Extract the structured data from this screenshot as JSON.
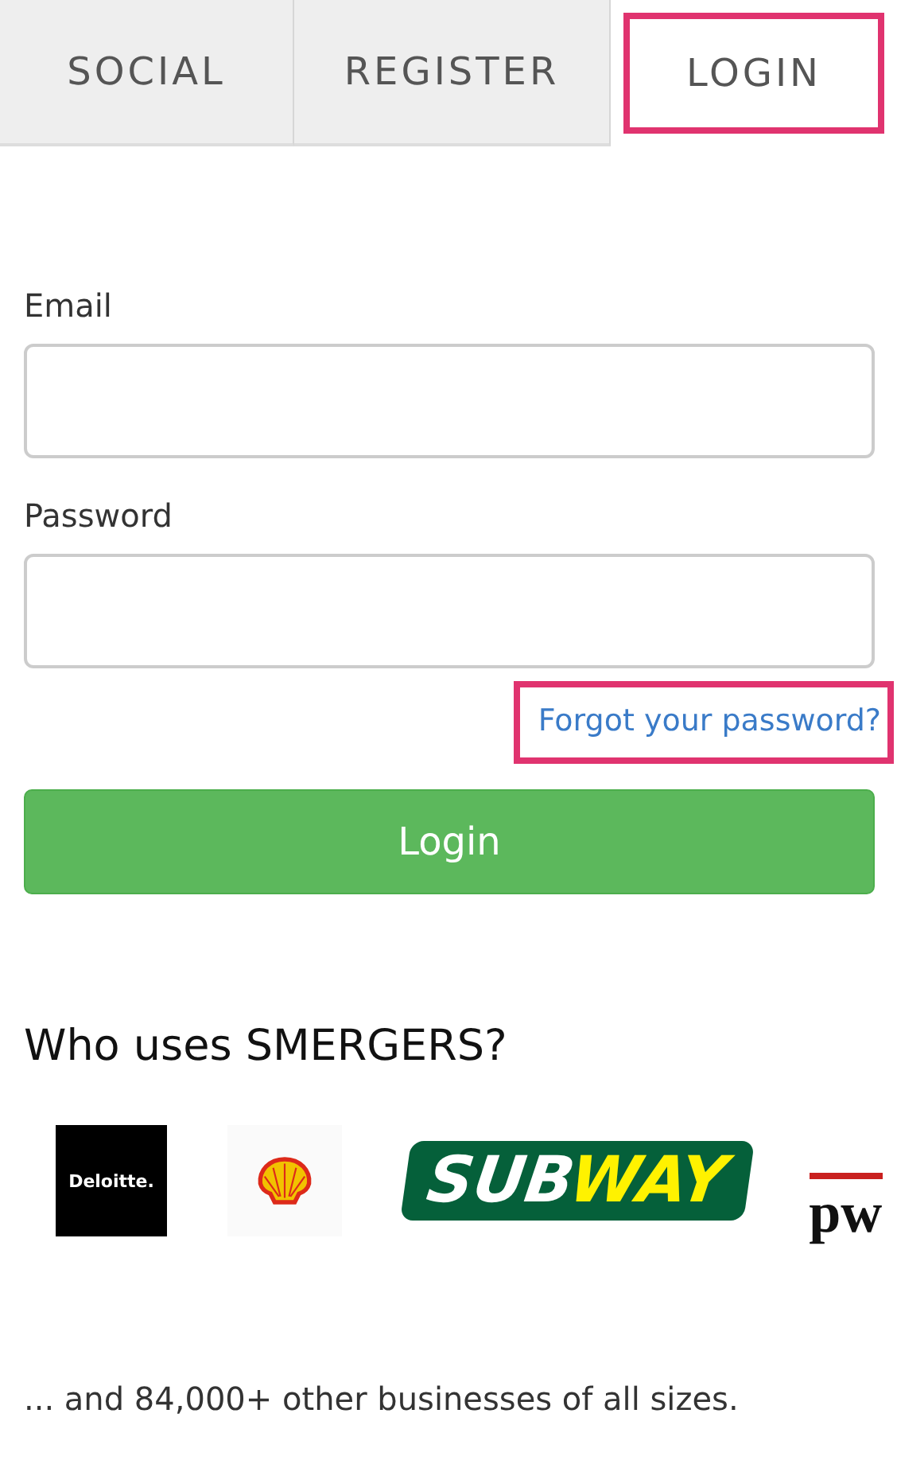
{
  "tabs": [
    {
      "label": "SOCIAL",
      "selected": false,
      "highlighted": false
    },
    {
      "label": "REGISTER",
      "selected": false,
      "highlighted": false
    },
    {
      "label": "LOGIN",
      "selected": true,
      "highlighted": true
    }
  ],
  "form": {
    "fields": [
      {
        "label": "Email"
      },
      {
        "label": "Password"
      }
    ],
    "forgot_link": {
      "text": "Forgot your password?",
      "highlighted": true
    },
    "submit": "Login"
  },
  "clients": {
    "heading": "Who uses SMERGERS?",
    "logos": [
      {
        "kind": "deloitte",
        "text": "Deloitte."
      },
      {
        "kind": "shell"
      },
      {
        "kind": "subway",
        "text": "SUBWAY"
      },
      {
        "kind": "pwc",
        "text": "pw"
      }
    ],
    "footer": "... and 84,000+ other businesses of all sizes."
  }
}
